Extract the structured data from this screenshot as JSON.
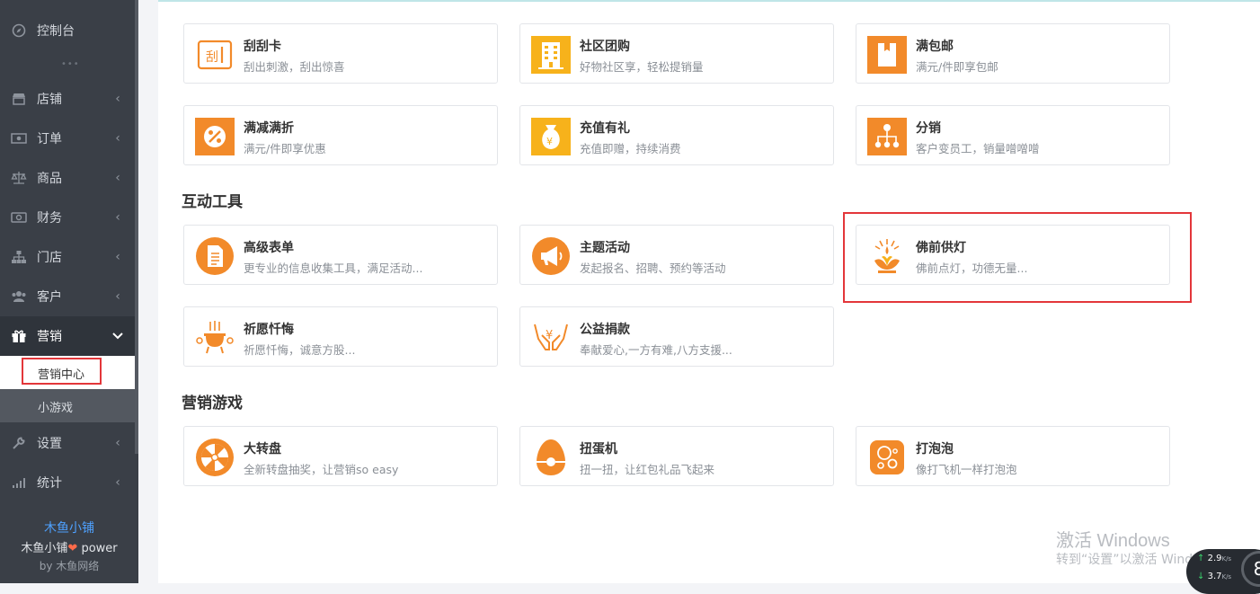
{
  "sidebar": {
    "items": [
      {
        "label": "控制台",
        "icon": "compass-icon"
      },
      {
        "label": "店铺",
        "icon": "store-icon"
      },
      {
        "label": "订单",
        "icon": "order-icon"
      },
      {
        "label": "商品",
        "icon": "scale-icon"
      },
      {
        "label": "财务",
        "icon": "money-icon"
      },
      {
        "label": "门店",
        "icon": "sitemap-icon"
      },
      {
        "label": "客户",
        "icon": "users-icon"
      },
      {
        "label": "营销",
        "icon": "gift-icon"
      },
      {
        "label": "设置",
        "icon": "wrench-icon"
      },
      {
        "label": "统计",
        "icon": "signal-icon"
      }
    ],
    "dots": "•••",
    "submenu": [
      {
        "label": "营销中心"
      },
      {
        "label": "小游戏"
      }
    ],
    "footer": {
      "brand": "木鱼小铺",
      "power_name": "木鱼小铺",
      "power_suffix": "power",
      "by": "by 木鱼网络"
    }
  },
  "cards_top": [
    {
      "title": "刮刮卡",
      "desc": "刮出刺激，刮出惊喜",
      "icon": "scratch-card-icon"
    },
    {
      "title": "社区团购",
      "desc": "好物社区享，轻松提销量",
      "icon": "building-icon"
    },
    {
      "title": "满包邮",
      "desc": "满元/件即享包邮",
      "icon": "package-icon"
    },
    {
      "title": "满减满折",
      "desc": "满元/件即享优惠",
      "icon": "percent-icon"
    },
    {
      "title": "充值有礼",
      "desc": "充值即赠，持续消费",
      "icon": "money-bag-icon"
    },
    {
      "title": "分销",
      "desc": "客户变员工，销量噌噌噌",
      "icon": "distribution-icon"
    }
  ],
  "sections": {
    "interactive": "互动工具",
    "games": "营销游戏"
  },
  "cards_interactive": [
    {
      "title": "高级表单",
      "desc": "更专业的信息收集工具，满足活动...",
      "icon": "form-document-icon"
    },
    {
      "title": "主题活动",
      "desc": "发起报名、招聘、预约等活动",
      "icon": "megaphone-icon"
    },
    {
      "title": "佛前供灯",
      "desc": "佛前点灯，功德无量...",
      "icon": "lotus-lamp-icon"
    },
    {
      "title": "祈愿忏悔",
      "desc": "祈愿忏悔，诚意方股...",
      "icon": "incense-burner-icon"
    },
    {
      "title": "公益捐款",
      "desc": "奉献爱心,一方有难,八方支援...",
      "icon": "donation-hands-icon"
    }
  ],
  "cards_games": [
    {
      "title": "大转盘",
      "desc": "全新转盘抽奖，让营销so easy",
      "icon": "wheel-icon"
    },
    {
      "title": "扭蛋机",
      "desc": "扭一扭，让红包礼品飞起来",
      "icon": "egg-icon"
    },
    {
      "title": "打泡泡",
      "desc": "像打飞机一样打泡泡",
      "icon": "bubbles-icon"
    }
  ],
  "watermark": {
    "line1": "激活 Windows",
    "line2": "转到“设置”以激活 Windows。"
  },
  "network": {
    "up": "2.9",
    "down": "3.7",
    "unit": "K/s",
    "ring": "8"
  },
  "colors": {
    "sidebar_bg": "#3a3f47",
    "accent_orange": "#f28a2a",
    "highlight_red": "#e3363a",
    "brand_blue": "#4ea1ff"
  }
}
